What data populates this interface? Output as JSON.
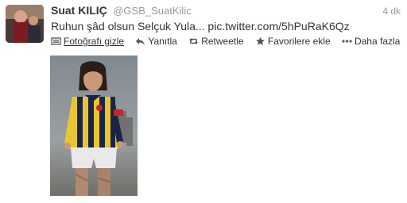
{
  "tweet": {
    "fullname": "Suat KILIÇ",
    "screenname": "@GSB_SuatKilic",
    "timestamp": "4 dk",
    "text": "Ruhun şâd olsun Selçuk Yula... pic.twitter.com/5hPuRaK6Qz"
  },
  "actions": {
    "hide_photo": "Fotoğrafı gizle",
    "reply": "Yanıtla",
    "retweet": "Retweetle",
    "favorite": "Favorilere ekle",
    "more": "Daha fazla"
  },
  "icons": {
    "hide_photo": "photo-icon",
    "reply": "reply-arrow-icon",
    "retweet": "retweet-icon",
    "favorite": "star-icon",
    "more": "ellipsis-icon"
  },
  "colors": {
    "name": "#333333",
    "muted": "#999999",
    "jersey_yellow": "#e8c632",
    "jersey_navy": "#1c2446"
  }
}
